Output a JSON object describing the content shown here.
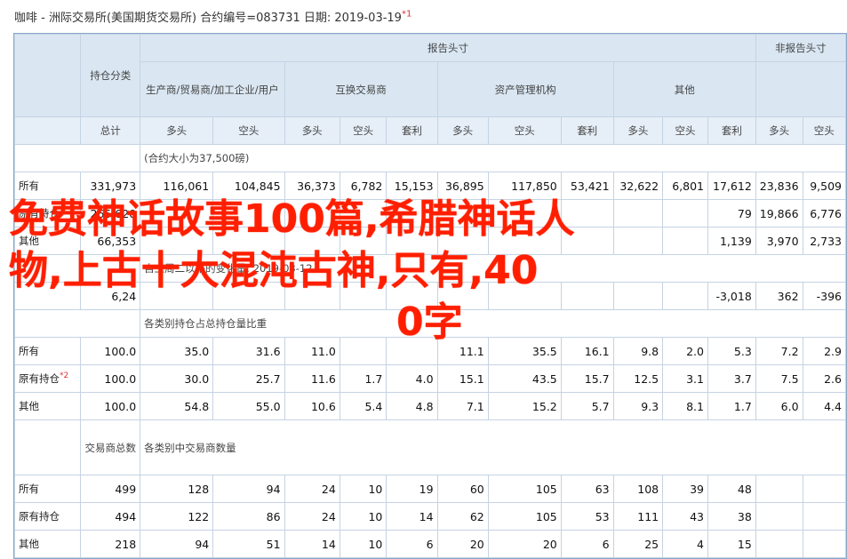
{
  "header_line": {
    "text": "咖啡 - 洲际交易所(美国期货交易所)  合约编号=083731  日期: 2019-03-19",
    "footnote_mark": "*1"
  },
  "table": {
    "group_reportable": "报告头寸",
    "group_nonreportable": "非报告头寸",
    "col_holding_category": "持仓分类",
    "col_producer": "生产商/贸易商/加工企业/用户",
    "col_swap": "互换交易商",
    "col_managed": "资产管理机构",
    "col_other": "其他",
    "sub_total": "总计",
    "sub_long": "多头",
    "sub_short": "空头",
    "sub_spread": "套利",
    "note_contract": "(合约大小为37,500磅)",
    "section1_rows": [
      {
        "label": "所有",
        "values": [
          "331,973",
          "116,061",
          "104,845",
          "36,373",
          "6,782",
          "15,153",
          "36,895",
          "117,850",
          "53,421",
          "32,622",
          "6,801",
          "17,612",
          "23,836",
          "9,509"
        ]
      },
      {
        "label": "原有持仓",
        "values": [
          "265,620",
          "",
          "",
          "",
          "",
          "",
          "",
          "",
          "",
          "",
          "",
          "79",
          "19,866",
          "6,776"
        ]
      },
      {
        "label": "其他",
        "values": [
          "66,353",
          "",
          "",
          "",
          "",
          "",
          "",
          "",
          "",
          "",
          "",
          "1,139",
          "3,970",
          "2,733"
        ]
      }
    ],
    "note_change": "自上周二以来的变化量: 2019-03-12",
    "change_row": {
      "label": "",
      "values": [
        "6,24",
        "",
        "",
        "",
        "",
        "",
        "",
        "",
        "",
        "",
        "",
        "-3,018",
        "362",
        "-396"
      ]
    },
    "note_pct": "各类别持仓占总持仓量比重",
    "section2_rows": [
      {
        "label": "所有",
        "values": [
          "100.0",
          "35.0",
          "31.6",
          "11.0",
          "",
          "",
          "11.1",
          "35.5",
          "16.1",
          "9.8",
          "2.0",
          "5.3",
          "7.2",
          "2.9"
        ]
      },
      {
        "label": "原有持仓",
        "label_mark": "*2",
        "values": [
          "100.0",
          "30.0",
          "25.7",
          "11.6",
          "1.7",
          "4.0",
          "15.1",
          "43.5",
          "15.7",
          "12.5",
          "3.1",
          "3.7",
          "7.5",
          "2.6"
        ]
      },
      {
        "label": "其他",
        "values": [
          "100.0",
          "54.8",
          "55.0",
          "10.6",
          "5.4",
          "4.8",
          "7.1",
          "15.2",
          "5.7",
          "9.3",
          "8.1",
          "1.7",
          "6.0",
          "4.4"
        ]
      }
    ],
    "col_traders": "交易商总数",
    "note_traders": "各类别中交易商数量",
    "section3_rows": [
      {
        "label": "所有",
        "values": [
          "499",
          "128",
          "94",
          "24",
          "10",
          "19",
          "60",
          "105",
          "63",
          "108",
          "39",
          "48",
          "",
          ""
        ]
      },
      {
        "label": "原有持仓",
        "values": [
          "494",
          "122",
          "86",
          "24",
          "10",
          "14",
          "62",
          "105",
          "53",
          "111",
          "43",
          "38",
          "",
          ""
        ]
      },
      {
        "label": "其他",
        "values": [
          "218",
          "94",
          "51",
          "14",
          "10",
          "6",
          "20",
          "20",
          "6",
          "25",
          "4",
          "15",
          "",
          ""
        ]
      }
    ]
  },
  "overlay": {
    "line1": "免费神话故事100篇,希腊神话人",
    "line2": "物,上古十大混沌古神,只有,40",
    "line3": "0字",
    "color": "#ff1f00"
  }
}
